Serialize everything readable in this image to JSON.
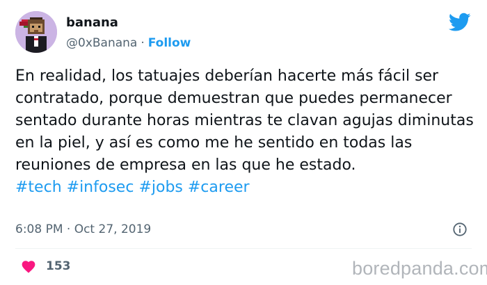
{
  "author": {
    "name": "banana",
    "handle": "@0xBanana",
    "separator": "·",
    "follow_label": "Follow"
  },
  "tweet": {
    "text": "En realidad, los tatuajes deberían hacerte más fácil ser contratado, porque demuestran que puedes permanecer sentado durante horas mientras te clavan agujas diminutas en la piel, y así es como me he sentido en todas las reuniones de empresa en las que he estado.",
    "hashtags": [
      "#tech",
      "#infosec",
      "#jobs",
      "#career"
    ]
  },
  "meta": {
    "timestamp": "6:08 PM · Oct 27, 2019"
  },
  "actions": {
    "like_count": "153"
  },
  "watermark": {
    "text": "boredpanda.com"
  },
  "colors": {
    "accent": "#1d9bf0",
    "like": "#f91880",
    "secondary_text": "#536471",
    "watermark": "#b1b5ba"
  },
  "icons": {
    "brand": "twitter-bird-icon",
    "info": "info-icon",
    "like": "heart-icon"
  }
}
